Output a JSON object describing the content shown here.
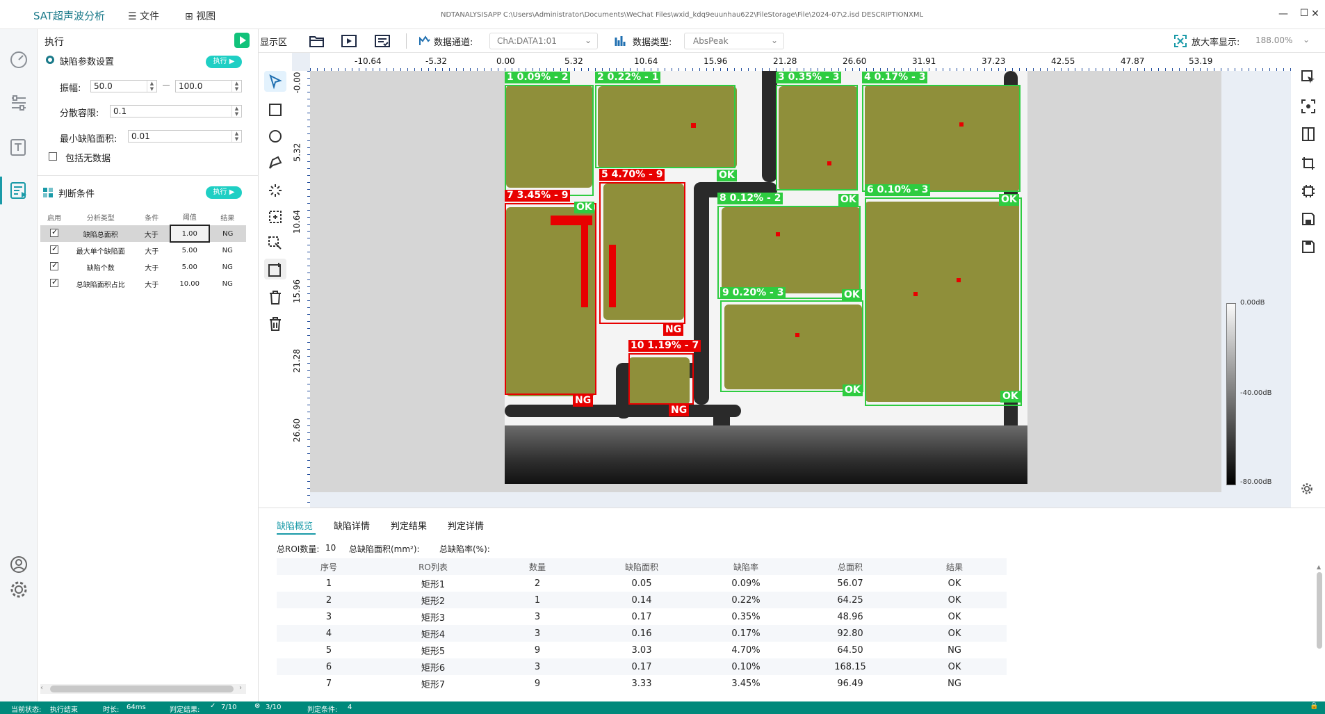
{
  "titlebar": {
    "app_name": "SAT超声波分析",
    "menu_file": "文件",
    "menu_view": "视图",
    "path": "NDTANALYSISAPP   C:\\Users\\Administrator\\Documents\\WeChat Files\\wxid_kdq9euunhau622\\FileStorage\\File\\2024-07\\2.isd   DESCRIPTIONXML",
    "minimize": "—",
    "maximize": "☐",
    "close": "✕"
  },
  "leftpanel": {
    "header": "执行",
    "section1_title": "缺陷参数设置",
    "run_label": "执行",
    "amplitude_label": "振幅:",
    "amplitude_min": "50.0",
    "amplitude_max": "100.0",
    "tolerance_label": "分散容限:",
    "tolerance_value": "0.1",
    "min_area_label": "最小缺陷面积:",
    "min_area_value": "0.01",
    "include_empty_label": "包括无数据",
    "section2_title": "判断条件",
    "cond_headers": [
      "启用",
      "分析类型",
      "条件",
      "阈值",
      "结果"
    ],
    "conditions": [
      {
        "enabled": true,
        "type": "缺陷总面积",
        "cond": "大于",
        "threshold": "1.00",
        "result": "NG"
      },
      {
        "enabled": true,
        "type": "最大单个缺陷面",
        "cond": "大于",
        "threshold": "5.00",
        "result": "NG"
      },
      {
        "enabled": true,
        "type": "缺陷个数",
        "cond": "大于",
        "threshold": "5.00",
        "result": "NG"
      },
      {
        "enabled": true,
        "type": "总缺陷面积占比",
        "cond": "大于",
        "threshold": "10.00",
        "result": "NG"
      }
    ]
  },
  "toolbar": {
    "display_area": "显示区",
    "channel_label": "数据通道:",
    "channel_value": "ChA:DATA1:01",
    "datatype_label": "数据类型:",
    "datatype_value": "AbsPeak",
    "zoom_label": "放大率显示:",
    "zoom_value": "188.00%"
  },
  "ruler": {
    "x_ticks": [
      "-10.64",
      "-5.32",
      "0.00",
      "5.32",
      "10.64",
      "15.96",
      "21.28",
      "26.60",
      "31.91",
      "37.23",
      "42.55",
      "47.87",
      "53.19"
    ],
    "y_ticks": [
      "-0.00",
      "5.32",
      "10.64",
      "15.96",
      "21.28",
      "26.60"
    ]
  },
  "colorbar": {
    "top": "0.00dB",
    "mid": "-40.00dB",
    "bottom": "-80.00dB"
  },
  "rois": [
    {
      "label": "1  0.09% - 2",
      "result": "OK"
    },
    {
      "label": "2  0.22% - 1",
      "result": "OK"
    },
    {
      "label": "3  0.35% - 3",
      "result": "OK"
    },
    {
      "label": "4  0.17% - 3",
      "result": "OK"
    },
    {
      "label": "5  4.70% - 9",
      "result": "NG"
    },
    {
      "label": "6  0.10% - 3",
      "result": "OK"
    },
    {
      "label": "7  3.45% - 9",
      "result": "NG"
    },
    {
      "label": "8  0.12% - 2",
      "result": "OK"
    },
    {
      "label": "9  0.20% - 3",
      "result": "OK"
    },
    {
      "label": "10  1.19% - 7",
      "result": "NG"
    }
  ],
  "bottom": {
    "tabs": [
      "缺陷概览",
      "缺陷详情",
      "判定结果",
      "判定详情"
    ],
    "summary_roi_label": "总ROI数量:",
    "summary_roi_value": "10",
    "summary_area_label": "总缺陷面积(mm²):",
    "summary_rate_label": "总缺陷率(%):",
    "headers": [
      "序号",
      "RO列表",
      "数量",
      "缺陷面积",
      "缺陷率",
      "总面积",
      "结果"
    ],
    "rows": [
      [
        "1",
        "矩形1",
        "2",
        "0.05",
        "0.09%",
        "56.07",
        "OK"
      ],
      [
        "2",
        "矩形2",
        "1",
        "0.14",
        "0.22%",
        "64.25",
        "OK"
      ],
      [
        "3",
        "矩形3",
        "3",
        "0.17",
        "0.35%",
        "48.96",
        "OK"
      ],
      [
        "4",
        "矩形4",
        "3",
        "0.16",
        "0.17%",
        "92.80",
        "OK"
      ],
      [
        "5",
        "矩形5",
        "9",
        "3.03",
        "4.70%",
        "64.50",
        "NG"
      ],
      [
        "6",
        "矩形6",
        "3",
        "0.17",
        "0.10%",
        "168.15",
        "OK"
      ],
      [
        "7",
        "矩形7",
        "9",
        "3.33",
        "3.45%",
        "96.49",
        "NG"
      ]
    ]
  },
  "status": {
    "state_label": "当前状态:",
    "state_value": "执行结束",
    "time_label": "时长:",
    "time_value": "64ms",
    "result_label": "判定结果:",
    "ok_count": "7/10",
    "ng_count": "3/10",
    "cond_label": "判定条件:",
    "cond_value": "4"
  }
}
